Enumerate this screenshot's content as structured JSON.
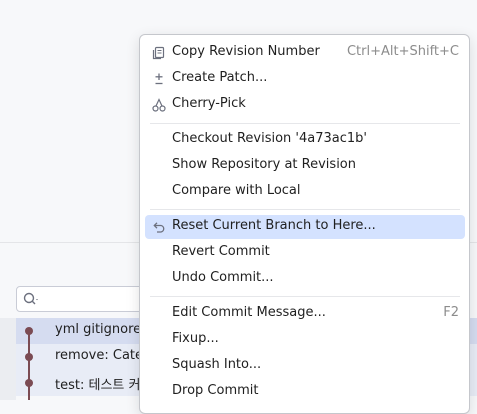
{
  "context_menu": {
    "items": [
      {
        "label": "Copy Revision Number",
        "shortcut": "Ctrl+Alt+Shift+C",
        "icon": "copy-icon"
      },
      {
        "label": "Create Patch...",
        "shortcut": "",
        "icon": "patch-icon"
      },
      {
        "label": "Cherry-Pick",
        "shortcut": "",
        "icon": "cherry-pick-icon"
      },
      {
        "label": "Checkout Revision '4a73ac1b'",
        "shortcut": ""
      },
      {
        "label": "Show Repository at Revision",
        "shortcut": ""
      },
      {
        "label": "Compare with Local",
        "shortcut": ""
      },
      {
        "label": "Reset Current Branch to Here...",
        "shortcut": "",
        "icon": "undo-arrow-icon",
        "highlighted": true
      },
      {
        "label": "Revert Commit",
        "shortcut": ""
      },
      {
        "label": "Undo Commit...",
        "shortcut": ""
      },
      {
        "label": "Edit Commit Message...",
        "shortcut": "F2"
      },
      {
        "label": "Fixup...",
        "shortcut": ""
      },
      {
        "label": "Squash Into...",
        "shortcut": ""
      },
      {
        "label": "Drop Commit",
        "shortcut": ""
      }
    ]
  },
  "commit_list": {
    "rows": [
      {
        "message": "yml gitignore",
        "selected": true
      },
      {
        "message": "remove: Cate",
        "selected": false
      },
      {
        "message": "test: 테스트 커",
        "selected": false
      }
    ]
  },
  "search": {
    "placeholder": ""
  },
  "colors": {
    "highlight": "#d4e2ff",
    "graph_node": "#7b4b53",
    "selected_row": "#d5dcf0"
  }
}
